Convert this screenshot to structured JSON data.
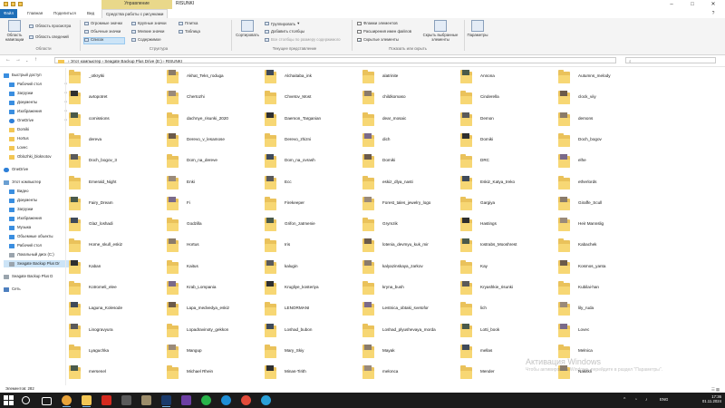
{
  "window": {
    "title": "RISUNKI",
    "context_tab": "Управление"
  },
  "tabs": [
    "Файл",
    "Главная",
    "Поделиться",
    "Вид",
    "Средства работы с рисунками"
  ],
  "ribbon": {
    "nav_pane": "Область навигации",
    "preview_pane": "Область просмотра",
    "details_pane": "Область сведений",
    "panes_group": "Области",
    "layout": {
      "huge": "Огромные значки",
      "large": "Крупные значки",
      "medium": "Обычные значки",
      "small": "Мелкие значки",
      "list": "Список",
      "table": "Таблица",
      "tiles": "Плитка",
      "content": "Содержимое",
      "group": "Структура"
    },
    "sort": "Сортировать",
    "group_by": "Группировать",
    "add_columns": "Добавить столбцы",
    "fit_columns": "Все столбцы по размеру содержимого",
    "view_group": "Текущее представление",
    "checkboxes": "Флажки элементов",
    "extensions": "Расширения имен файлов",
    "hidden_items": "Скрытые элементы",
    "hide_selected": "Скрыть выбранные элементы",
    "showhide_group": "Показать или скрыть",
    "options": "Параметры"
  },
  "address": {
    "path": [
      "Этот компьютер",
      "Seagate Backup Plus Drive (E:)",
      "RISUNKI"
    ]
  },
  "sidebar": {
    "items": [
      {
        "label": "Быстрый доступ",
        "icon": "star-icon",
        "pinned": false
      },
      {
        "label": "Рабочий стол",
        "icon": "desktop-icon",
        "pinned": true
      },
      {
        "label": "Загрузки",
        "icon": "download-icon",
        "pinned": true
      },
      {
        "label": "Документы",
        "icon": "documents-icon",
        "pinned": true
      },
      {
        "label": "Изображения",
        "icon": "pictures-icon",
        "pinned": true
      },
      {
        "label": "OneDrive",
        "icon": "cloud-icon",
        "pinned": true
      },
      {
        "label": "Domiki",
        "icon": "folder-icon",
        "pinned": false
      },
      {
        "label": "Hortus",
        "icon": "folder-icon",
        "pinned": false
      },
      {
        "label": "Lovec",
        "icon": "folder-icon",
        "pinned": false
      },
      {
        "label": "Oblozhki_bloknotov",
        "icon": "folder-icon",
        "pinned": false
      },
      {
        "label": "OneDrive",
        "icon": "cloud-icon",
        "pinned": false
      },
      {
        "label": "Этот компьютер",
        "icon": "computer-icon",
        "pinned": false
      },
      {
        "label": "Видео",
        "icon": "video-icon",
        "pinned": false
      },
      {
        "label": "Документы",
        "icon": "documents-icon",
        "pinned": false
      },
      {
        "label": "Загрузки",
        "icon": "download-icon",
        "pinned": false
      },
      {
        "label": "Изображения",
        "icon": "pictures-icon",
        "pinned": false
      },
      {
        "label": "Музыка",
        "icon": "music-icon",
        "pinned": false
      },
      {
        "label": "Объемные объекты",
        "icon": "3d-objects-icon",
        "pinned": false
      },
      {
        "label": "Рабочий стол",
        "icon": "desktop-icon",
        "pinned": false
      },
      {
        "label": "Локальный диск (C:)",
        "icon": "drive-icon",
        "pinned": false
      },
      {
        "label": "Seagate Backup Plus Dr",
        "icon": "drive-icon",
        "pinned": false
      },
      {
        "label": "Seagate Backup Plus D",
        "icon": "drive-icon",
        "pinned": false
      },
      {
        "label": "Сеть",
        "icon": "network-icon",
        "pinned": false
      }
    ]
  },
  "folders": [
    "_otkrytki",
    "Akhat_Teks_roduga",
    "Alchaitaba_ink",
    "alatrinite",
    "Annona",
    "Autumns_melody",
    "avtopotret",
    "Chertozhi",
    "Chvetov_Most",
    "childkomaso",
    "Cinderella",
    "clock_viiy",
    "comissions",
    "dachnye_risunki_2020",
    "Daemon_Targanian",
    "dear_mosaic",
    "Demon",
    "demons",
    "dereva",
    "Derevo_v_lesamose",
    "Derevo_zhizni",
    "dich",
    "Domiki",
    "Doch_bogov",
    "Doch_bogov_3",
    "Dom_na_dereve",
    "Dom_na_ovrash",
    "Domiki",
    "DRC",
    "elhe",
    "Emerald_Night",
    "Enki",
    "Ecc",
    "eskiz_dlya_nasti",
    "Eskiz_Katya_treko",
    "etherlords",
    "Fairy_Dream",
    "Fi",
    "Firekeeper",
    "Forest_tales_jewelry_logo",
    "Gargiya",
    "Giraffe_Scull",
    "Glaz_loshadi",
    "Godzilla",
    "Grifon_zatmenie",
    "Grymzik",
    "Hastings",
    "Heir Mannslig",
    "Home_skull_eskiz",
    "Hortus",
    "Iris",
    "lotenia_devmyu_kuk_mir",
    "Iostrabs_Mooshrest",
    "Kabachek",
    "Kaban",
    "Kaitus",
    "kalugin",
    "kalyazinskaya_zarkov",
    "Kay",
    "Kosmos_yanta",
    "Kotromeli_elee",
    "Krab_Lompania",
    "Krugliye_kosteriya",
    "kryna_bush",
    "Kryashkie_risunki",
    "Kubilai-han",
    "Laguna_Kolesode",
    "Lapa_medvedya_eskiz",
    "LENORMANI",
    "Lestnica_obtaki_svetofor",
    "lich",
    "lily_ruda",
    "Linogravyura",
    "Lopadravinoty_gekkon",
    "Loshad_bubon",
    "Loshad_plyushevaya_morda",
    "Lotti_book",
    "Lovec",
    "Lyaguchka",
    "Mangup",
    "Mary_Skiy",
    "Mayak",
    "mellas",
    "Melnica",
    "mersenel",
    "Michael Rhein",
    "Minas-Tirith",
    "melonca",
    "Mender",
    "Nakitkli"
  ],
  "status": {
    "count": "Элементов: 282"
  },
  "watermark": {
    "title": "Активация Windows",
    "subtitle": "Чтобы активировать Windows, перейдите в раздел \"Параметры\"."
  },
  "taskbar": {
    "lang": "ENG",
    "time": "17:36",
    "date": "01.11.2024",
    "apps": [
      {
        "icon": "search-icon",
        "color": "#1b1b1b"
      },
      {
        "icon": "task-view-icon",
        "color": "#1b1b1b"
      },
      {
        "icon": "chrome-icon",
        "color": "#e8a33a"
      },
      {
        "icon": "explorer-icon",
        "color": "#f3c654"
      },
      {
        "icon": "acrobat-icon",
        "color": "#d42a1f"
      },
      {
        "icon": "ms-store-icon",
        "color": "#5a5a5a"
      },
      {
        "icon": "files-icon",
        "color": "#9c8c6a"
      },
      {
        "icon": "photoshop-icon",
        "color": "#1a3a6b"
      },
      {
        "icon": "paint-icon",
        "color": "#6d3fa3"
      },
      {
        "icon": "whatsapp-icon",
        "color": "#29b34a"
      },
      {
        "icon": "edge-icon",
        "color": "#1e8ed6"
      },
      {
        "icon": "yandex-browser-icon",
        "color": "#e24b3a"
      },
      {
        "icon": "telegram-icon",
        "color": "#2aa0d8"
      }
    ]
  },
  "colors": {
    "accent": "#1f6fb8",
    "context_tab": "#e9d88a",
    "folder": "#f7d774",
    "selection": "#cce4f7",
    "taskbar": "#1b1b1b"
  }
}
